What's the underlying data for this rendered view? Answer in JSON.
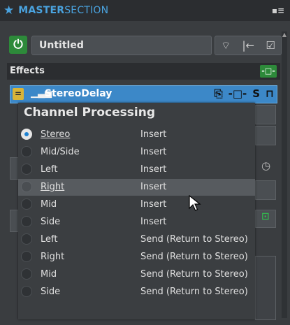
{
  "panel": {
    "star_icon": "star-icon",
    "title_bold": "MASTER",
    "title_rest": "SECTION",
    "menu_glyph": "▪≡"
  },
  "preset": {
    "name": "Untitled",
    "power_glyph": "⏻"
  },
  "effects": {
    "label": "Effects",
    "add_glyph": "-□-"
  },
  "plugin": {
    "name": "StereoDelay",
    "meter_glyph": "▁▃▅",
    "min_glyph": "=",
    "solo_glyph": "S"
  },
  "channel_processing": {
    "heading": "Channel Processing",
    "options": [
      {
        "label": "Stereo",
        "mode": "Insert",
        "selected": true
      },
      {
        "label": "Mid/Side",
        "mode": "Insert",
        "selected": false
      },
      {
        "label": "Left",
        "mode": "Insert",
        "selected": false
      },
      {
        "label": "Right",
        "mode": "Insert",
        "selected": false,
        "hovered": true
      },
      {
        "label": "Mid",
        "mode": "Insert",
        "selected": false
      },
      {
        "label": "Side",
        "mode": "Insert",
        "selected": false
      },
      {
        "label": "Left",
        "mode": "Send (Return to Stereo)",
        "selected": false
      },
      {
        "label": "Right",
        "mode": "Send (Return to Stereo)",
        "selected": false
      },
      {
        "label": "Mid",
        "mode": "Send (Return to Stereo)",
        "selected": false
      },
      {
        "label": "Side",
        "mode": "Send (Return to Stereo)",
        "selected": false
      }
    ]
  },
  "colors": {
    "accent": "#4aa3df",
    "power_green": "#2d8a3a",
    "plugin_blue": "#3c88c8",
    "radio_dot": "#1d82d2"
  }
}
